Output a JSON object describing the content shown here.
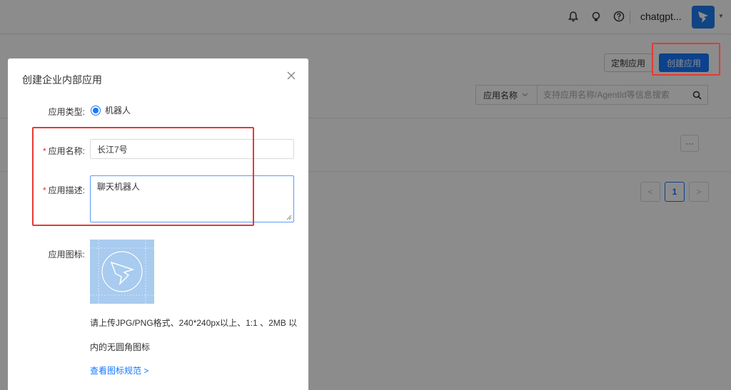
{
  "header": {
    "username": "chatgpt...",
    "icons": [
      "bell-icon",
      "bulb-icon",
      "help-icon"
    ]
  },
  "toolbar": {
    "custom_app_label": "定制应用",
    "create_app_label": "创建应用"
  },
  "search": {
    "select_label": "应用名称",
    "placeholder": "支持应用名称/AgentId等信息搜索"
  },
  "list": {
    "more_label": "···"
  },
  "pagination": {
    "prev": "<",
    "current": "1",
    "next": ">"
  },
  "modal": {
    "title": "创建企业内部应用",
    "app_type_label": "应用类型:",
    "app_type_option": "机器人",
    "name_label": "应用名称:",
    "name_value": "长江7号",
    "desc_label": "应用描述:",
    "desc_value": "聊天机器人",
    "icon_label": "应用图标:",
    "hint_line1": "请上传JPG/PNG格式、240*240px以上、1:1 、2MB 以",
    "hint_line2": "内的无圆角图标",
    "link_text": "查看图标规范 >",
    "required_mark": "*"
  },
  "colors": {
    "primary": "#1677ff",
    "highlight": "#e53935",
    "icon_tile": "#a8cbef"
  }
}
